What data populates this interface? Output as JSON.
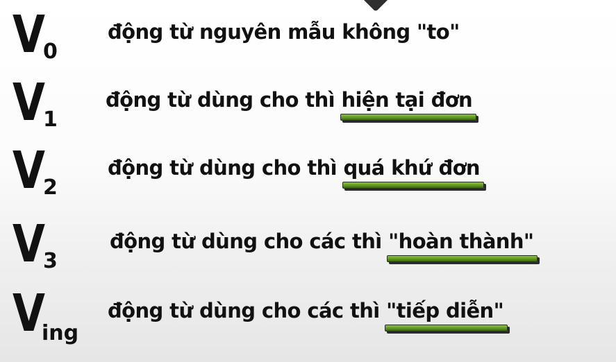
{
  "rows": [
    {
      "letter": "V",
      "sub": "0",
      "text": "động từ nguyên mẫu không \"to\"",
      "highlight": ""
    },
    {
      "letter": "V",
      "sub": "1",
      "text": "động từ dùng cho thì ",
      "highlight": "hiện tại đơn"
    },
    {
      "letter": "V",
      "sub": "2",
      "text": "động từ dùng cho thì ",
      "highlight": "quá khứ đơn"
    },
    {
      "letter": "V",
      "sub": "3",
      "text": "động từ dùng cho các thì ",
      "highlight": "\"hoàn thành\""
    },
    {
      "letter": "V",
      "sub": "ing",
      "text": "động từ dùng cho các thì ",
      "highlight": "\"tiếp diễn\""
    }
  ],
  "colors": {
    "underline": "#6aa22a",
    "text": "#111111"
  }
}
